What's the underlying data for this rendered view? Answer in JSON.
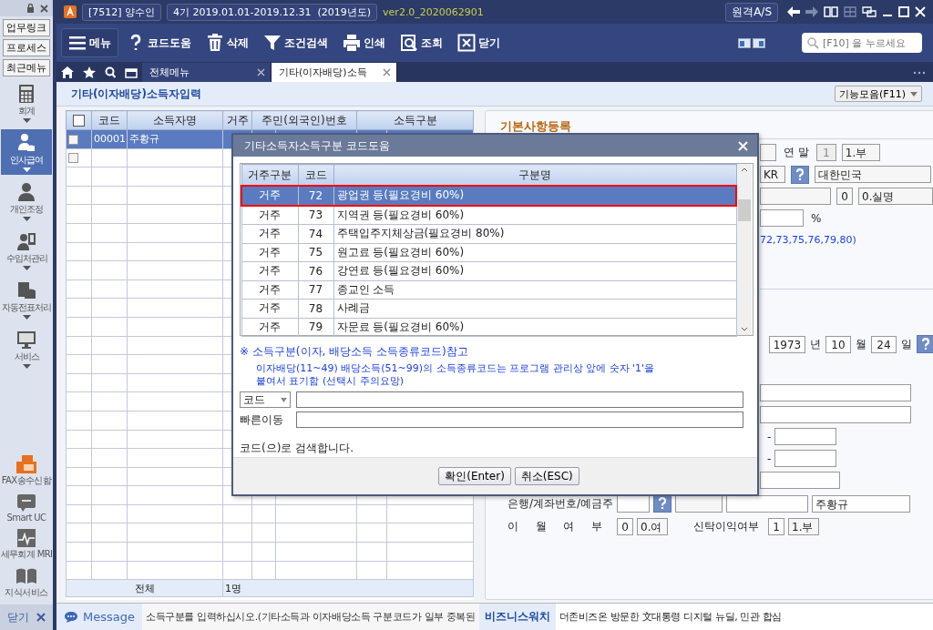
{
  "title_bar": {
    "company": "[7512] 양수인",
    "period": "4기  2019.01.01-2019.12.31",
    "fiscal_year": "(2019년도)",
    "version": "ver2.0_2020062901",
    "remote_button": "원격A/S"
  },
  "sidebar": {
    "quick_buttons": [
      "업무링크",
      "프로세스",
      "최근메뉴"
    ],
    "items": [
      {
        "label": "회계",
        "kind": "calculator",
        "selected": false
      },
      {
        "label": "인사급여",
        "kind": "payroll",
        "selected": true
      },
      {
        "label": "개인조정",
        "kind": "person",
        "selected": false
      },
      {
        "label": "수임처관리",
        "kind": "client",
        "selected": false
      },
      {
        "label": "자동전표처리",
        "kind": "database",
        "selected": false
      },
      {
        "label": "서비스",
        "kind": "monitor",
        "selected": false
      }
    ],
    "apps": [
      {
        "label": "FAX송수신함",
        "kind": "fax"
      },
      {
        "label": "Smart UC",
        "kind": "uc"
      },
      {
        "label": "세무회계 MRI",
        "kind": "pulse"
      },
      {
        "label": "지식서비스",
        "kind": "book"
      }
    ],
    "close": "닫기"
  },
  "toolbar": {
    "buttons": [
      {
        "label": "메뉴",
        "kind": "menu"
      },
      {
        "label": "코드도움",
        "kind": "help"
      },
      {
        "label": "삭제",
        "kind": "trash"
      },
      {
        "label": "조건검색",
        "kind": "filter"
      },
      {
        "label": "인쇄",
        "kind": "print"
      },
      {
        "label": "조회",
        "kind": "lookup"
      },
      {
        "label": "닫기",
        "kind": "close"
      }
    ],
    "search": {
      "placeholder": "[F10] 을 누르세요"
    }
  },
  "tabs": [
    {
      "label": "전체메뉴",
      "selected": false
    },
    {
      "label": "기타(이자배당)소득",
      "selected": true
    }
  ],
  "page": {
    "title": "기타(이자배당)소득자입력",
    "actions_button": "기능모음(F11)"
  },
  "grid": {
    "select_all": {
      "checked": false
    },
    "columns": [
      "코드",
      "소득자명",
      "거주",
      "주민(외국인)번호",
      "소득구분"
    ],
    "rows": [
      {
        "code": "00001",
        "name": "주황규",
        "selected": true,
        "checked": false
      },
      {
        "selected": false,
        "checked": false
      }
    ],
    "total_label": "전체",
    "total_count": "1명"
  },
  "form": {
    "title": "기본사항등록",
    "year_end_label": "연 말",
    "year_end_code": "1",
    "year_end_value": "1.부",
    "country_code": "KR",
    "country_name": "대한민국",
    "name_type_code": "0",
    "name_type_value": "0.실명",
    "percent_unit": "%",
    "code_note": "72,73,75,76,79,80)",
    "birth": {
      "year": "1973",
      "year_unit": "년",
      "month": "10",
      "month_unit": "월",
      "day": "24",
      "day_unit": "일"
    },
    "dashes": [
      "-",
      "-"
    ],
    "bank_label": "은행/계좌번호/예금주",
    "account_holder": "주황규",
    "carryover_label": [
      "이",
      "월",
      "여",
      "부"
    ],
    "carryover_code": "0",
    "carryover_value": "0.여",
    "trust_label": "신탁이익여부",
    "trust_code": "1",
    "trust_value": "1.부"
  },
  "dialog": {
    "title": "기타소득자소득구분 코드도움",
    "columns": [
      "거주구분",
      "코드",
      "구분명"
    ],
    "rows": [
      {
        "residency": "거주",
        "code": "72",
        "name": "광업권 등(필요경비 60%)",
        "selected": true
      },
      {
        "residency": "거주",
        "code": "73",
        "name": "지역권 등(필요경비 60%)",
        "selected": false
      },
      {
        "residency": "거주",
        "code": "74",
        "name": "주택입주지체상금(필요경비 80%)",
        "selected": false
      },
      {
        "residency": "거주",
        "code": "75",
        "name": "원고료 등(필요경비 60%)",
        "selected": false
      },
      {
        "residency": "거주",
        "code": "76",
        "name": "강연료 등(필요경비 60%)",
        "selected": false
      },
      {
        "residency": "거주",
        "code": "77",
        "name": "종교인 소득",
        "selected": false
      },
      {
        "residency": "거주",
        "code": "78",
        "name": "사례금",
        "selected": false
      },
      {
        "residency": "거주",
        "code": "79",
        "name": "자문료 등(필요경비 60%)",
        "selected": false
      }
    ],
    "note_title": "※ 소득구분(이자, 배당소득 소득종류코드)참고",
    "note": "이자배당(11~49) 배당소득(51~99)의 소득종류코드는 프로그램 관리상 앞에 숫자 '1'을 붙여서 표기함 (선택시 주의요망)",
    "search_type": "코드",
    "quick_move_label": "빠른이동",
    "status": "코드(으)로 검색합니다.",
    "buttons": [
      "확인(Enter)",
      "취소(ESC)"
    ]
  },
  "status_bar": {
    "message_label": "Message",
    "message": "소득구분를 입력하십시오.(기타소득과 이자배당소득 구분코드가 일부 중복된",
    "news_source": "비즈니스워치",
    "headline": "더존비즈온 방문한 文대통령 디지털 뉴딜, 민관 합심"
  }
}
